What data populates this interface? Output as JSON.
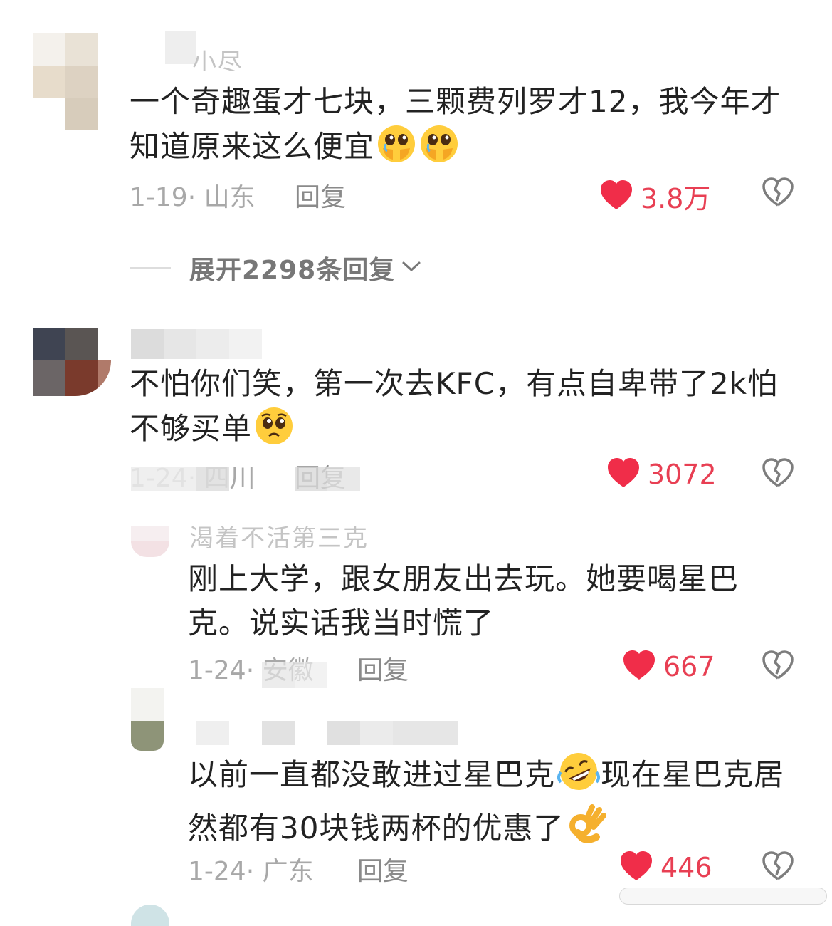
{
  "comments": [
    {
      "username": "小尽",
      "text": "一个奇趣蛋才七块，三颗费列罗才12，我今年才知道原来这么便宜",
      "date": "1-19",
      "location": "山东",
      "reply_label": "回复",
      "likes": "3.8万",
      "expand_label": "展开2298条回复",
      "emojis": [
        "teary-face-hands-emoji",
        "teary-face-hands-emoji"
      ]
    },
    {
      "username": "",
      "text": "不怕你们笑，第一次去KFC，有点自卑带了2k怕不够买单",
      "date": "1-24",
      "location": "四川",
      "reply_label": "回复",
      "likes": "3072",
      "emojis": [
        "pleading-face-emoji"
      ]
    }
  ],
  "replies": [
    {
      "username": "渴着不活第三克",
      "text": "刚上大学，跟女朋友出去玩。她要喝星巴克。说实话我当时慌了",
      "date": "1-24",
      "location": "安徽",
      "reply_label": "回复",
      "likes": "667"
    },
    {
      "username": "",
      "text_part1": "以前一直都没敢进过星巴克",
      "text_part2": "现在星巴克居然都有30块钱两杯的优惠了",
      "date": "1-24",
      "location": "广东",
      "reply_label": "回复",
      "likes": "446",
      "emojis": [
        "rolling-laughing-emoji",
        "ok-hand-emoji"
      ]
    }
  ],
  "colors": {
    "like_red": "#e83f53",
    "meta_gray": "#a8a8a8",
    "text_dark": "#222222"
  }
}
